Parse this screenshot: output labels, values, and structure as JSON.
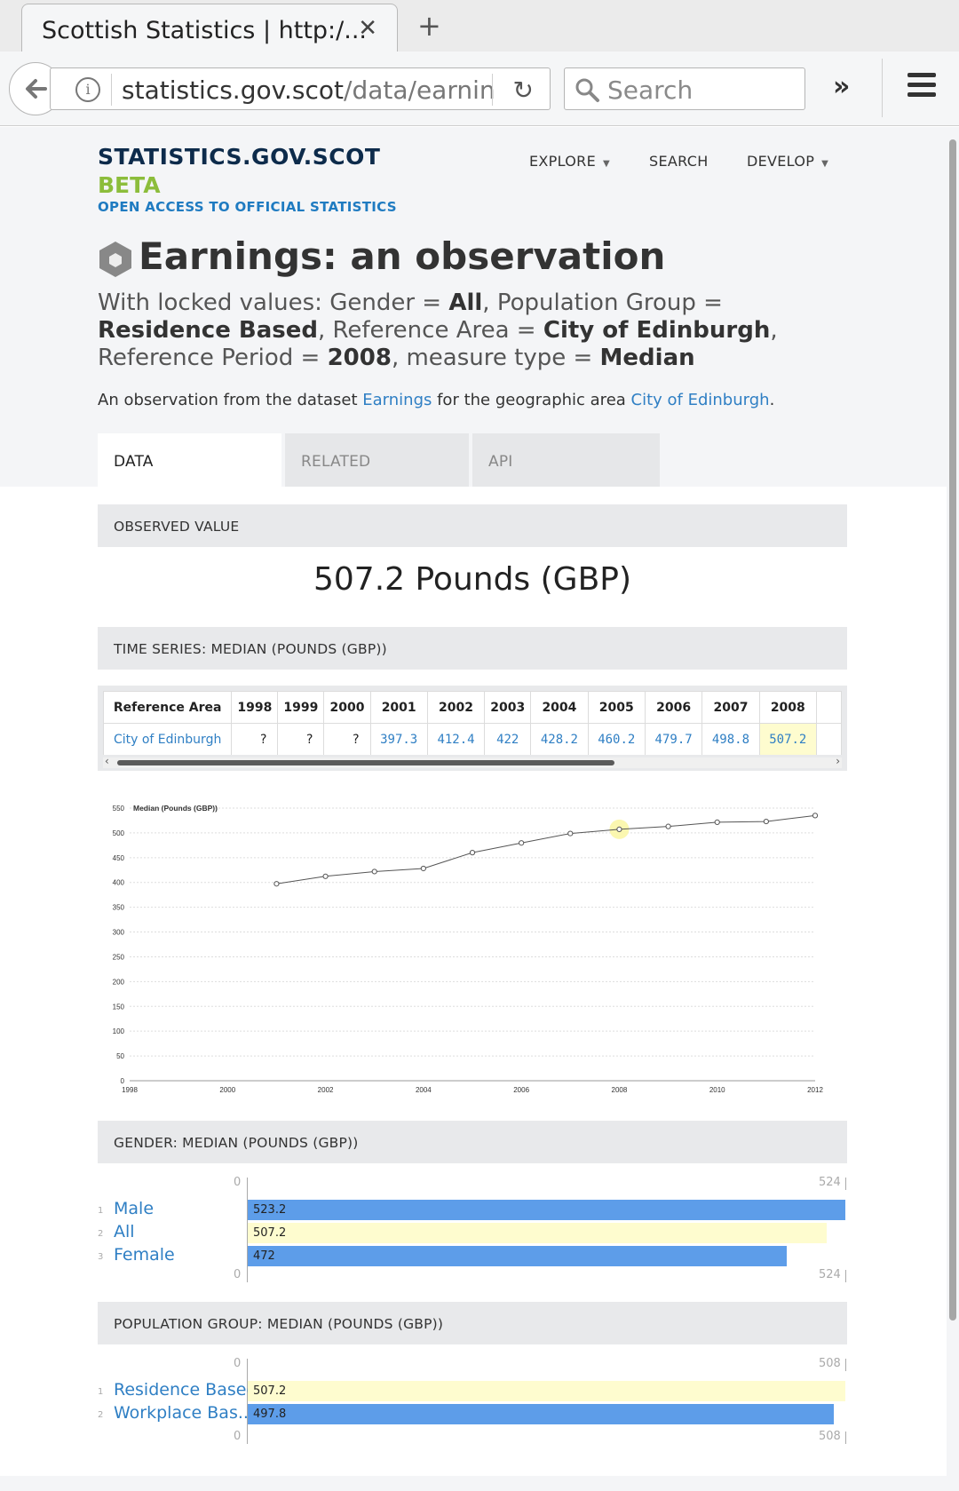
{
  "browser": {
    "tab_title": "Scottish Statistics | http:/...",
    "url_domain": "statistics.gov.scot",
    "url_path": "/data/earnin",
    "search_placeholder": "Search"
  },
  "site": {
    "brand": "STATISTICS.GOV.SCOT",
    "beta": "BETA",
    "tagline": "OPEN ACCESS TO OFFICIAL STATISTICS",
    "nav": [
      "EXPLORE",
      "SEARCH",
      "DEVELOP"
    ]
  },
  "header": {
    "title": "Earnings: an observation",
    "locked_prefix": "With locked values: Gender = ",
    "gender": "All",
    "pop_prefix": ", Population Group = ",
    "population_group": "Residence Based",
    "area_prefix": ", Reference Area = ",
    "reference_area": "City of Edinburgh",
    "period_prefix": ", Reference Period = ",
    "reference_period": "2008",
    "measure_prefix": ", measure type = ",
    "measure_type": "Median",
    "intro_prefix": "An observation from the dataset ",
    "intro_dataset": "Earnings",
    "intro_middle": " for the geographic area ",
    "intro_area": "City of Edinburgh",
    "intro_suffix": "."
  },
  "tabs": [
    "DATA",
    "RELATED",
    "API"
  ],
  "observed": {
    "section": "OBSERVED VALUE",
    "value": "507.2 Pounds (GBP)"
  },
  "timeseries": {
    "section": "TIME SERIES: MEDIAN (POUNDS (GBP))",
    "col_header": "Reference Area",
    "years": [
      "1998",
      "1999",
      "2000",
      "2001",
      "2002",
      "2003",
      "2004",
      "2005",
      "2006",
      "2007",
      "2008"
    ],
    "area": "City of Edinburgh",
    "values": [
      "?",
      "?",
      "?",
      "397.3",
      "412.4",
      "422",
      "428.2",
      "460.2",
      "479.7",
      "498.8",
      "507.2"
    ],
    "highlight_year": "2008"
  },
  "chart_data": {
    "type": "line",
    "title": "Median (Pounds (GBP))",
    "x": [
      2001,
      2002,
      2003,
      2004,
      2005,
      2006,
      2007,
      2008,
      2009,
      2010,
      2011,
      2012
    ],
    "values": [
      397.3,
      412.4,
      422,
      428.2,
      460.2,
      479.7,
      498.8,
      507.2,
      513,
      521.5,
      523,
      535
    ],
    "xlim": [
      1998,
      2012
    ],
    "ylim": [
      0,
      550
    ],
    "xticks": [
      "1998",
      "2000",
      "2002",
      "2004",
      "2006",
      "2008",
      "2010",
      "2012"
    ],
    "yticks": [
      "0",
      "50",
      "100",
      "150",
      "200",
      "250",
      "300",
      "350",
      "400",
      "450",
      "500",
      "550"
    ],
    "highlight_x": 2008,
    "grid": true,
    "line_color": "#555555",
    "highlight_color": "#fbf7b0"
  },
  "gender": {
    "section": "GENDER: MEDIAN (POUNDS (GBP))",
    "axis_min": "0",
    "axis_max": "524",
    "max": 524,
    "items": [
      {
        "idx": "1",
        "label": "Male",
        "value": 523.2,
        "text": "523.2",
        "highlight": false
      },
      {
        "idx": "2",
        "label": "All",
        "value": 507.2,
        "text": "507.2",
        "highlight": true
      },
      {
        "idx": "3",
        "label": "Female",
        "value": 472,
        "text": "472",
        "highlight": false
      }
    ]
  },
  "population": {
    "section": "POPULATION GROUP: MEDIAN (POUNDS (GBP))",
    "axis_min": "0",
    "axis_max": "508",
    "max": 508,
    "items": [
      {
        "idx": "1",
        "label": "Residence Based",
        "value": 507.2,
        "text": "507.2",
        "highlight": true
      },
      {
        "idx": "2",
        "label": "Workplace Bas...",
        "value": 497.8,
        "text": "497.8",
        "highlight": false
      }
    ]
  },
  "colors": {
    "bar": "#5d9de9",
    "bar_highlight": "#fefccf",
    "link": "#2f7fc4",
    "brand_navy": "#0d2b4b",
    "beta_green": "#8cbd3b"
  }
}
